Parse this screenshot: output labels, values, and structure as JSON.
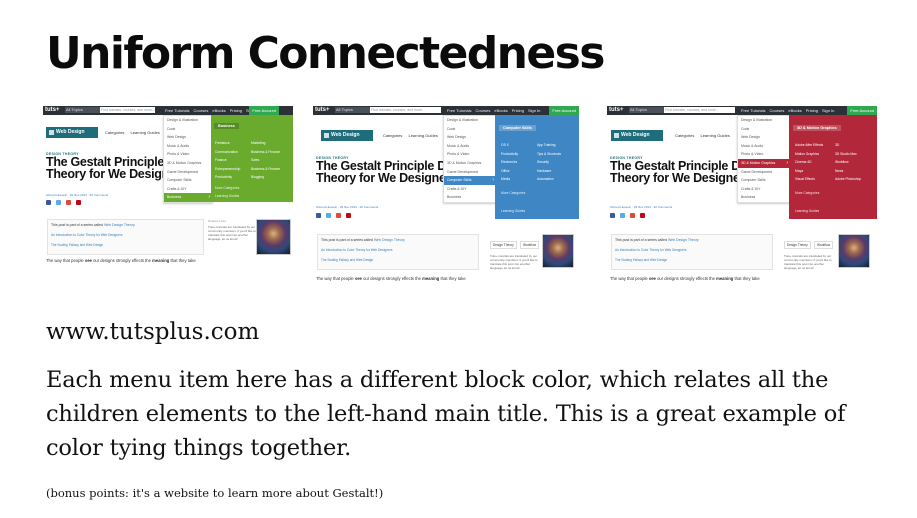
{
  "slide": {
    "title": "Uniform Connectedness",
    "url": "www.tutsplus.com",
    "description": "Each menu item here has a different block color, which relates all the children elements to the left-hand main title. This is a great example of color tying things together.",
    "bonus": "(bonus points: it's a website to learn more about Gestalt!)"
  },
  "site": {
    "logo": "tuts+",
    "topics_select": "All Topics",
    "search_placeholder": "Find tutorials, courses, and more...",
    "nav": [
      "Free Tutorials",
      "Courses",
      "eBooks",
      "Pricing",
      "Sign In"
    ],
    "cta": "Free Account",
    "section_badge": "Web Design",
    "sub_nav": [
      "Categories",
      "Learning Guides"
    ],
    "category": "DESIGN THEORY",
    "article_title": "The Gestalt Principles: Design Theory for Web Designers",
    "article_title_cropped": "The Gestalt Principle Design Theory for We Designers",
    "byline": "Ahmed Hussein  ·  29 Nov 2013  ·  30 Comments",
    "social_colors": [
      "#3b5998",
      "#55acee",
      "#dd4b39",
      "#dd4b39",
      "#bd081c"
    ],
    "series_intro": "This post is part of a series called",
    "series_name": "Web Design Theory",
    "series_links": [
      "An Introduction to Color Theory for Web Designers",
      "The Scaling Fallacy and Web Design"
    ],
    "sidebar_label": "Related Links",
    "sidebar_tags": [
      "Design Theory",
      "Workflow"
    ],
    "sidebar_text": "Tuts+ tutorials are translated by our community members. If you'd like to translate this post into another language, let us know!",
    "body_start": "The way that people",
    "body_see": "see",
    "body_mid": "our designs strongly effects the",
    "body_meaning": "meaning",
    "body_end": "that they take"
  },
  "menu_left": [
    "Design & Illustration",
    "Code",
    "Web Design",
    "Music & Audio",
    "Photo & Video",
    "3D & Motion Graphics",
    "Game Development",
    "Computer Skills",
    "Crafts & DIY",
    "Business"
  ],
  "panels": [
    {
      "color": "#6aab2e",
      "active_index": 9,
      "heading": "Business",
      "col1": [
        "Freelance",
        "Communication",
        "Finance",
        "Entrepreneurship",
        "Productivity"
      ],
      "col2": [
        "Marketing",
        "Business & Finance",
        "Sales",
        "Business & Finance",
        "Blogging"
      ],
      "footer": [
        "More Categories",
        "Learning Guides"
      ]
    },
    {
      "color": "#3f86c4",
      "active_index": 7,
      "heading": "Computer Skills",
      "col1": [
        "OS X",
        "Productivity",
        "Electronics",
        "Office",
        "Media"
      ],
      "col2": [
        "App Training",
        "Tips & Shortcuts",
        "Security",
        "Hardware",
        "Automation"
      ],
      "footer": [
        "More Categories",
        "Learning Guides"
      ]
    },
    {
      "color": "#b2283a",
      "active_index": 5,
      "heading": "3D & Motion Graphics",
      "col1": [
        "Adobe After Effects",
        "Motion Graphics",
        "Cinema 4D",
        "Maya",
        "Visual Effects"
      ],
      "col2": [
        "3D",
        "3D Studio Max",
        "Workflow",
        "News",
        "Adobe Photoshop"
      ],
      "footer": [
        "More Categories",
        "Learning Guides"
      ]
    }
  ]
}
